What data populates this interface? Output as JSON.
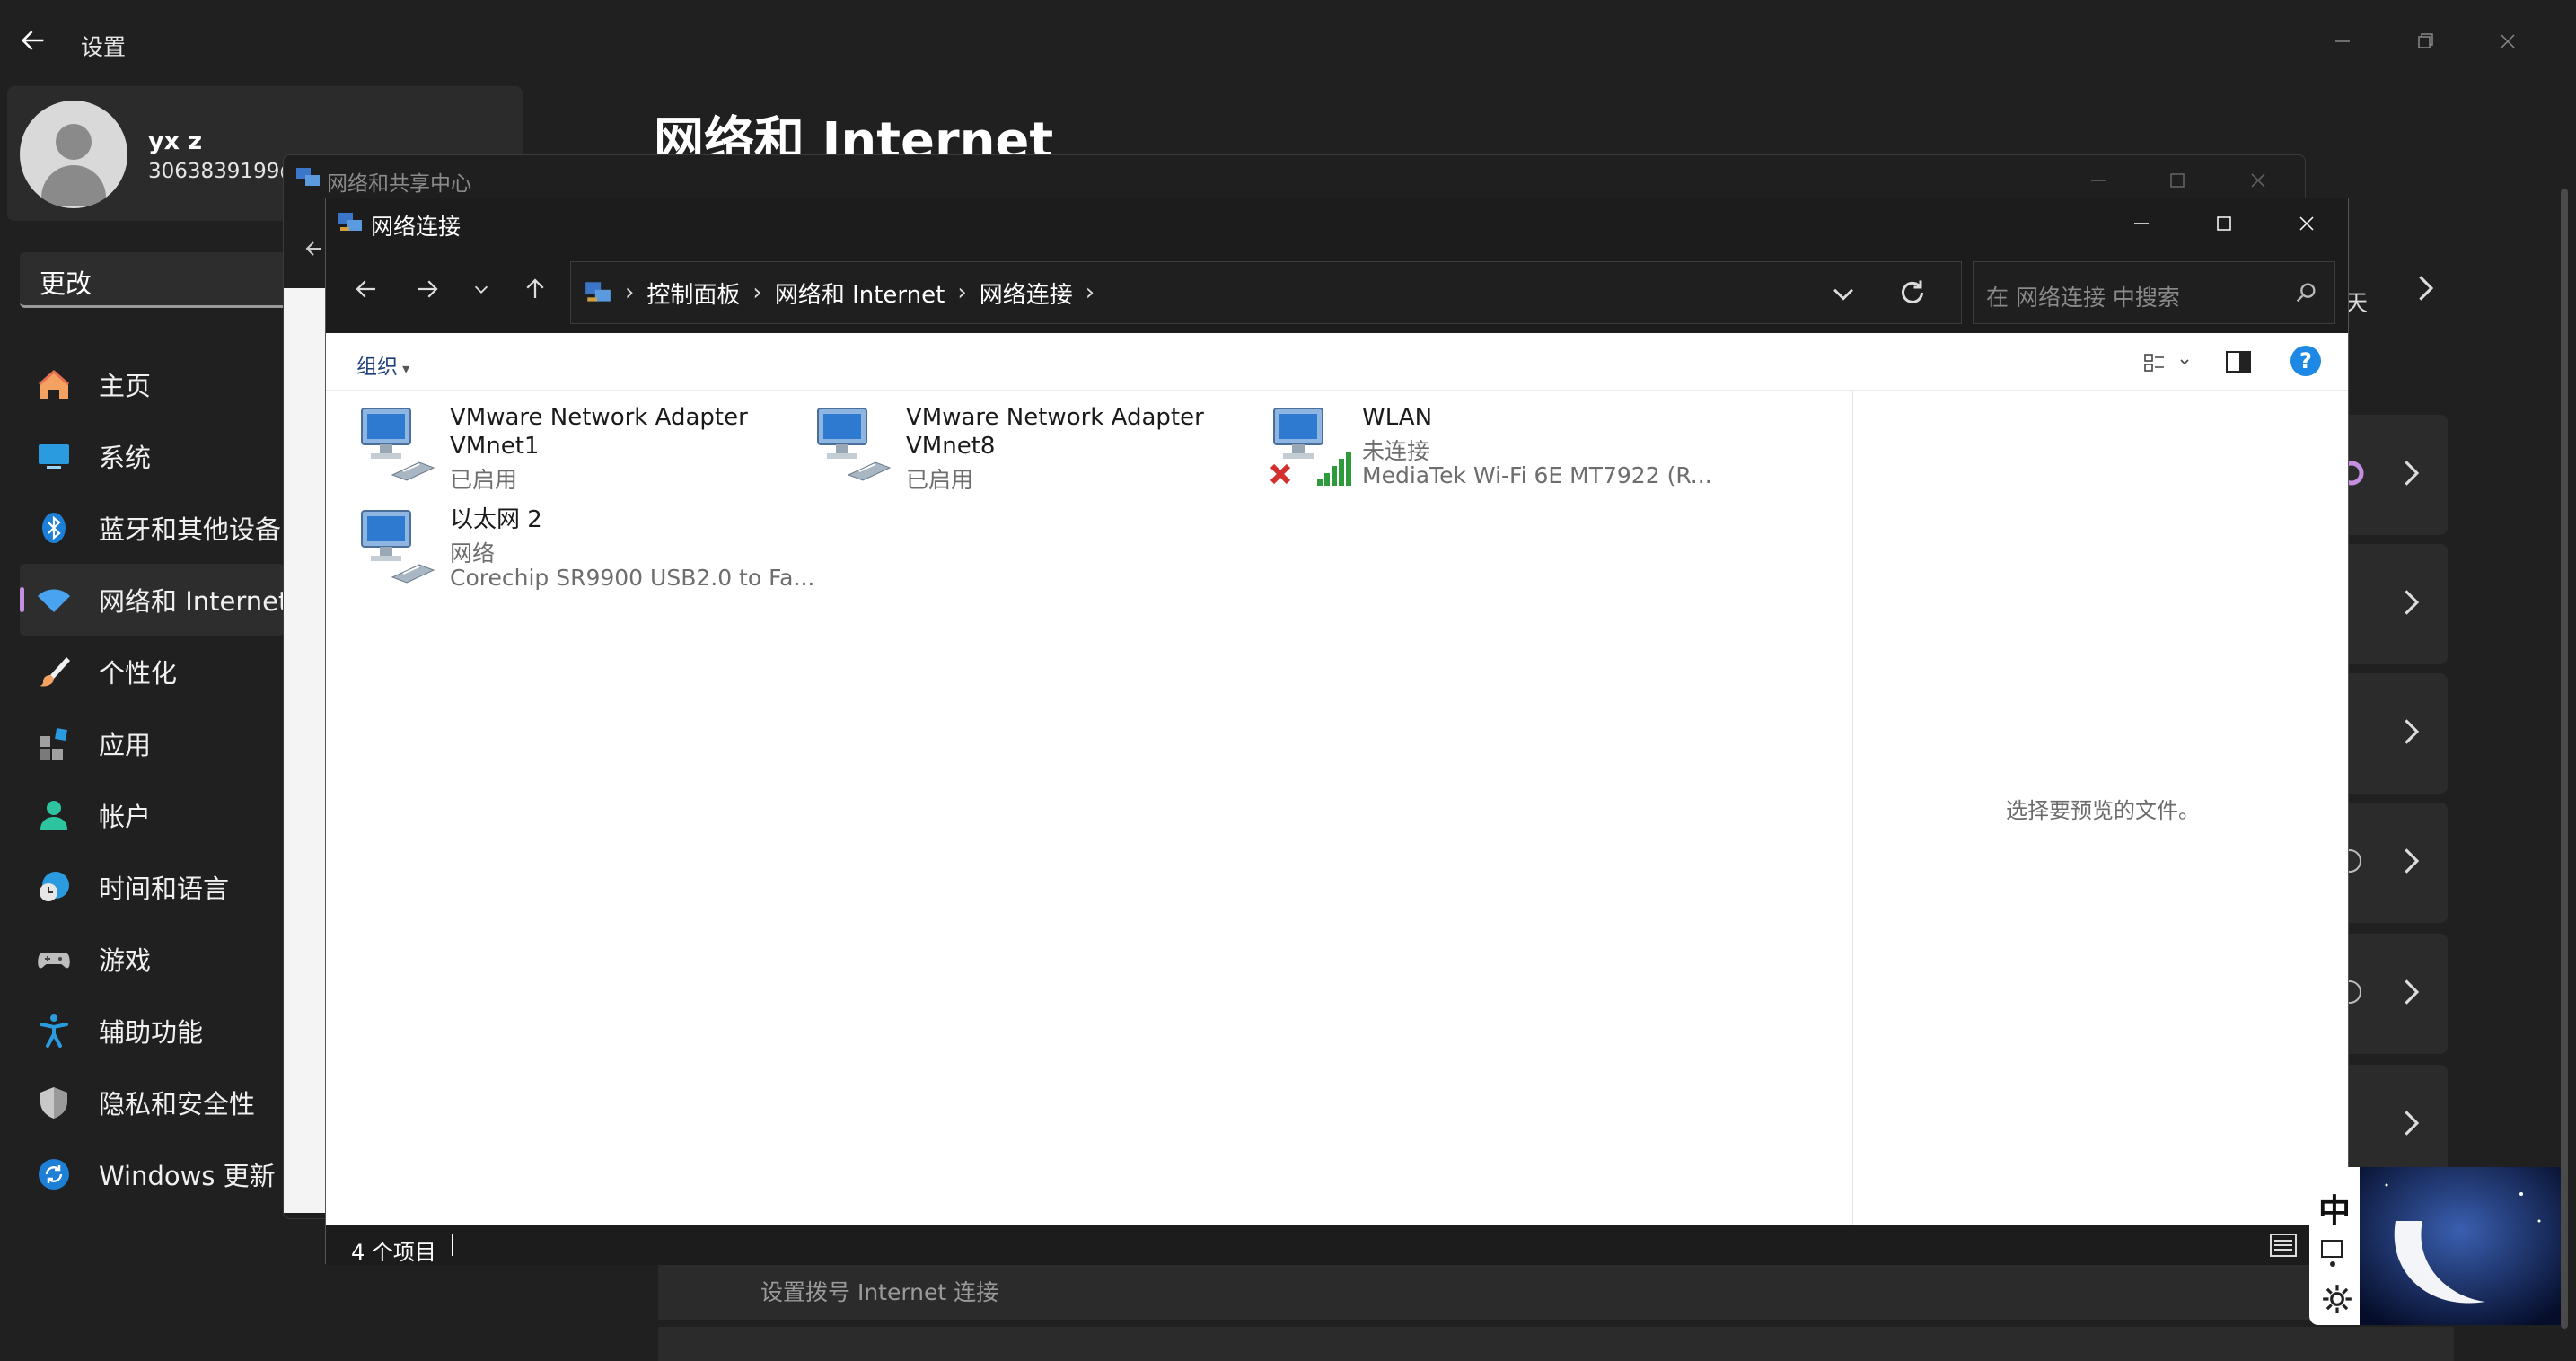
{
  "settings": {
    "title": "设置",
    "user_name": "yx z",
    "user_id": "3063839199@",
    "search_text": "更改",
    "page_title": "网络和 Internet",
    "right_fragment": "天",
    "bottom_item": "设置拨号 Internet 连接",
    "nav": [
      {
        "label": "主页"
      },
      {
        "label": "系统"
      },
      {
        "label": "蓝牙和其他设备"
      },
      {
        "label": "网络和 Internet"
      },
      {
        "label": "个性化"
      },
      {
        "label": "应用"
      },
      {
        "label": "帐户"
      },
      {
        "label": "时间和语言"
      },
      {
        "label": "游戏"
      },
      {
        "label": "辅助功能"
      },
      {
        "label": "隐私和安全性"
      },
      {
        "label": "Windows 更新"
      }
    ]
  },
  "sharing_center": {
    "title": "网络和共享中心"
  },
  "net_connections": {
    "title": "网络连接",
    "breadcrumbs": [
      "控制面板",
      "网络和 Internet",
      "网络连接"
    ],
    "search_placeholder": "在 网络连接 中搜索",
    "organize_label": "组织",
    "preview_text": "选择要预览的文件。",
    "item_count": "4 个项目",
    "items": [
      {
        "name": "VMware Network Adapter VMnet1",
        "status": "已启用",
        "device": ""
      },
      {
        "name": "VMware Network Adapter VMnet8",
        "status": "已启用",
        "device": ""
      },
      {
        "name": "WLAN",
        "status": "未连接",
        "device": "MediaTek Wi-Fi 6E MT7922 (R..."
      },
      {
        "name": "以太网 2",
        "status": "网络",
        "device": "Corechip SR9900 USB2.0 to Fa..."
      }
    ]
  },
  "ime": {
    "mode": "中"
  },
  "colors": {
    "accent": "#c48fe0",
    "help_blue": "#1e88e5",
    "error_red": "#d32f2f",
    "signal_green": "#2e9b3a"
  }
}
